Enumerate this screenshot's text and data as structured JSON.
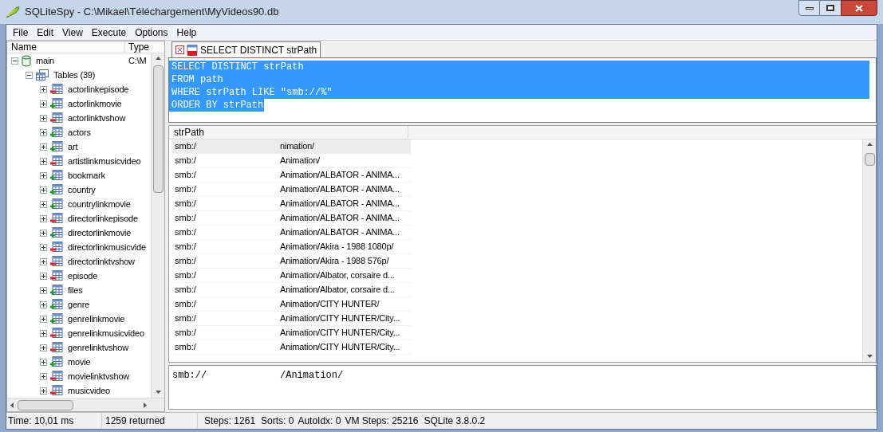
{
  "window": {
    "title": "SQLiteSpy - C:\\Mikael\\Téléchargement\\MyVideos90.db"
  },
  "menu": [
    "File",
    "Edit",
    "View",
    "Execute",
    "Options",
    "Help"
  ],
  "tree": {
    "columns": [
      "Name",
      "Type"
    ],
    "items": [
      {
        "label": "main",
        "type": "C:\\M",
        "kind": "database",
        "expanded": true,
        "children": [
          {
            "label": "Tables (39)",
            "kind": "tables",
            "expanded": true,
            "children": [
              {
                "label": "actorlinkepisode",
                "kind": "minus",
                "expanded": false
              },
              {
                "label": "actorlinkmovie",
                "kind": "plus",
                "expanded": false
              },
              {
                "label": "actorlinktvshow",
                "kind": "minus",
                "expanded": false
              },
              {
                "label": "actors",
                "kind": "plus",
                "expanded": false
              },
              {
                "label": "art",
                "kind": "plus",
                "expanded": false
              },
              {
                "label": "artistlinkmusicvideo",
                "kind": "minus",
                "expanded": false
              },
              {
                "label": "bookmark",
                "kind": "plus",
                "expanded": false
              },
              {
                "label": "country",
                "kind": "plus",
                "expanded": false
              },
              {
                "label": "countrylinkmovie",
                "kind": "plus",
                "expanded": false
              },
              {
                "label": "directorlinkepisode",
                "kind": "minus",
                "expanded": false
              },
              {
                "label": "directorlinkmovie",
                "kind": "plus",
                "expanded": false
              },
              {
                "label": "directorlinkmusicvide",
                "kind": "minus",
                "expanded": false
              },
              {
                "label": "directorlinktvshow",
                "kind": "minus",
                "expanded": false
              },
              {
                "label": "episode",
                "kind": "minus",
                "expanded": false
              },
              {
                "label": "files",
                "kind": "plus",
                "expanded": false
              },
              {
                "label": "genre",
                "kind": "plus",
                "expanded": false
              },
              {
                "label": "genrelinkmovie",
                "kind": "plus",
                "expanded": false
              },
              {
                "label": "genrelinkmusicvideo",
                "kind": "minus",
                "expanded": false
              },
              {
                "label": "genrelinktvshow",
                "kind": "minus",
                "expanded": false
              },
              {
                "label": "movie",
                "kind": "plus",
                "expanded": false
              },
              {
                "label": "movielinktvshow",
                "kind": "minus",
                "expanded": false
              },
              {
                "label": "musicvideo",
                "kind": "minus",
                "expanded": false
              }
            ]
          }
        ]
      }
    ]
  },
  "tabs": [
    {
      "label": "SELECT DISTINCT strPath",
      "selected": true
    }
  ],
  "editor": {
    "selected": true,
    "lines": [
      "SELECT DISTINCT strPath",
      "FROM path",
      "WHERE strPath LIKE \"smb://%\"",
      "ORDER BY strPath"
    ]
  },
  "results": {
    "columns": [
      "strPath"
    ],
    "rows": [
      {
        "prefix": "smb:/",
        "suffix": "nimation/",
        "selected": true
      },
      {
        "prefix": "smb:/",
        "suffix": "Animation/",
        "selected": false
      },
      {
        "prefix": "smb:/",
        "suffix": "Animation/ALBATOR - ANIMA...",
        "selected": false
      },
      {
        "prefix": "smb:/",
        "suffix": "Animation/ALBATOR - ANIMA...",
        "selected": false
      },
      {
        "prefix": "smb:/",
        "suffix": "Animation/ALBATOR - ANIMA...",
        "selected": false
      },
      {
        "prefix": "smb:/",
        "suffix": "Animation/ALBATOR - ANIMA...",
        "selected": false
      },
      {
        "prefix": "smb:/",
        "suffix": "Animation/ALBATOR - ANIMA...",
        "selected": false
      },
      {
        "prefix": "smb:/",
        "suffix": "Animation/Akira - 1988 1080p/",
        "selected": false
      },
      {
        "prefix": "smb:/",
        "suffix": "Animation/Akira - 1988 576p/",
        "selected": false
      },
      {
        "prefix": "smb:/",
        "suffix": "Animation/Albator, corsaire d...",
        "selected": false
      },
      {
        "prefix": "smb:/",
        "suffix": "Animation/Albator, corsaire d...",
        "selected": false
      },
      {
        "prefix": "smb:/",
        "suffix": "Animation/CITY HUNTER/",
        "selected": false
      },
      {
        "prefix": "smb:/",
        "suffix": "Animation/CITY HUNTER/City...",
        "selected": false
      },
      {
        "prefix": "smb:/",
        "suffix": "Animation/CITY HUNTER/City...",
        "selected": false
      },
      {
        "prefix": "smb:/",
        "suffix": "Animation/CITY HUNTER/City...",
        "selected": false
      }
    ]
  },
  "detail": {
    "prefix": "smb://",
    "suffix": "/Animation/"
  },
  "status_bar": {
    "time": "Time: 10,01 ms",
    "returned": "1259 returned",
    "stats": [
      "Steps: 1261",
      "Sorts: 0",
      "AutoIdx: 0",
      "VM Steps: 25216",
      "SQLite 3.8.0.2"
    ]
  }
}
